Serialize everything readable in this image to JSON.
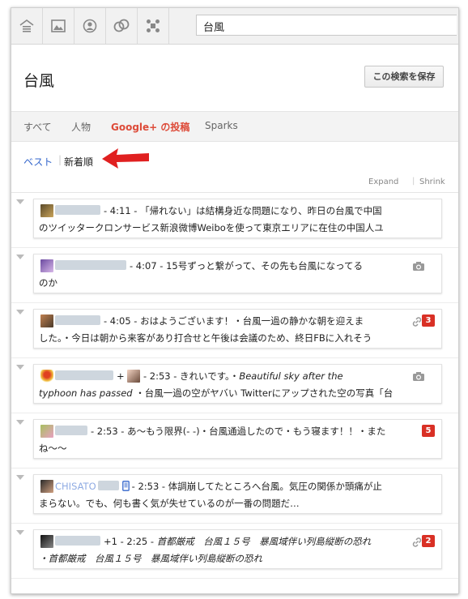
{
  "search": {
    "value": "台風"
  },
  "header": {
    "title": "台風",
    "save_button": "この検索を保存"
  },
  "tabs": [
    {
      "label": "すべて",
      "active": false
    },
    {
      "label": "人物",
      "active": false
    },
    {
      "label": "Google+ の投稿",
      "active": true
    },
    {
      "label": "Sparks",
      "active": false
    }
  ],
  "sort": {
    "best": "ベスト",
    "newest": "新着順"
  },
  "view": {
    "expand": "Expand",
    "shrink": "Shrink"
  },
  "colors": {
    "accent": "#dd4b39",
    "link": "#3366cc",
    "badge": "#d93025",
    "annotation_arrow": "#e02020"
  },
  "posts": [
    {
      "line1": "- 4:11 - 「帰れない」は結構身近な問題になり、昨日の台風で中国",
      "line2": "のツイッタークロンサービス新浪微博Weiboを使って東京エリアに在住の中国人ユ",
      "icon": null,
      "badge": null
    },
    {
      "line1": "- 4:07 - 15号ずっと繋がって、その先も台風になってる",
      "line2": "のか",
      "icon": "camera-icon",
      "badge": null
    },
    {
      "line1": "- 4:05 - おはようございます！・台風一過の静かな朝を迎えま",
      "line2": "した。・今日は朝から来客があり打合せと午後は会議のため、終日FBに入れそう",
      "icon": "link-icon",
      "badge": "3"
    },
    {
      "line1_pre": "+",
      "line1": "- 2:53 - きれいです。・",
      "line1_italic": "Beautiful sky after the",
      "line2_italic": "typhoon has passed",
      "line2": "・台風一過の空がヤバい Twitterにアップされた空の写真「台",
      "icon": "camera-icon",
      "badge": null
    },
    {
      "line1": "- 2:53 - あ〜もう限界(- -)・台風通過したので・もう寝ます！！・また",
      "line2": "ね〜〜",
      "icon": null,
      "badge": "5"
    },
    {
      "line1_name": "CHISATO",
      "line1": "- 2:53 - 体調崩してたところへ台風。気圧の関係か頭痛が止",
      "line2": "まらない。でも、何も書く気が失せているのが一番の問題だ…",
      "icon": null,
      "badge": null
    },
    {
      "line1_pre": "+1 - 2:25 -",
      "line1": "首都厳戒　台風１５号　暴風域伴い列島縦断の恐れ",
      "line2": "・首都厳戒　台風１５号　暴風域伴い列島縦断の恐れ",
      "icon": "link-icon",
      "badge": "2"
    }
  ]
}
